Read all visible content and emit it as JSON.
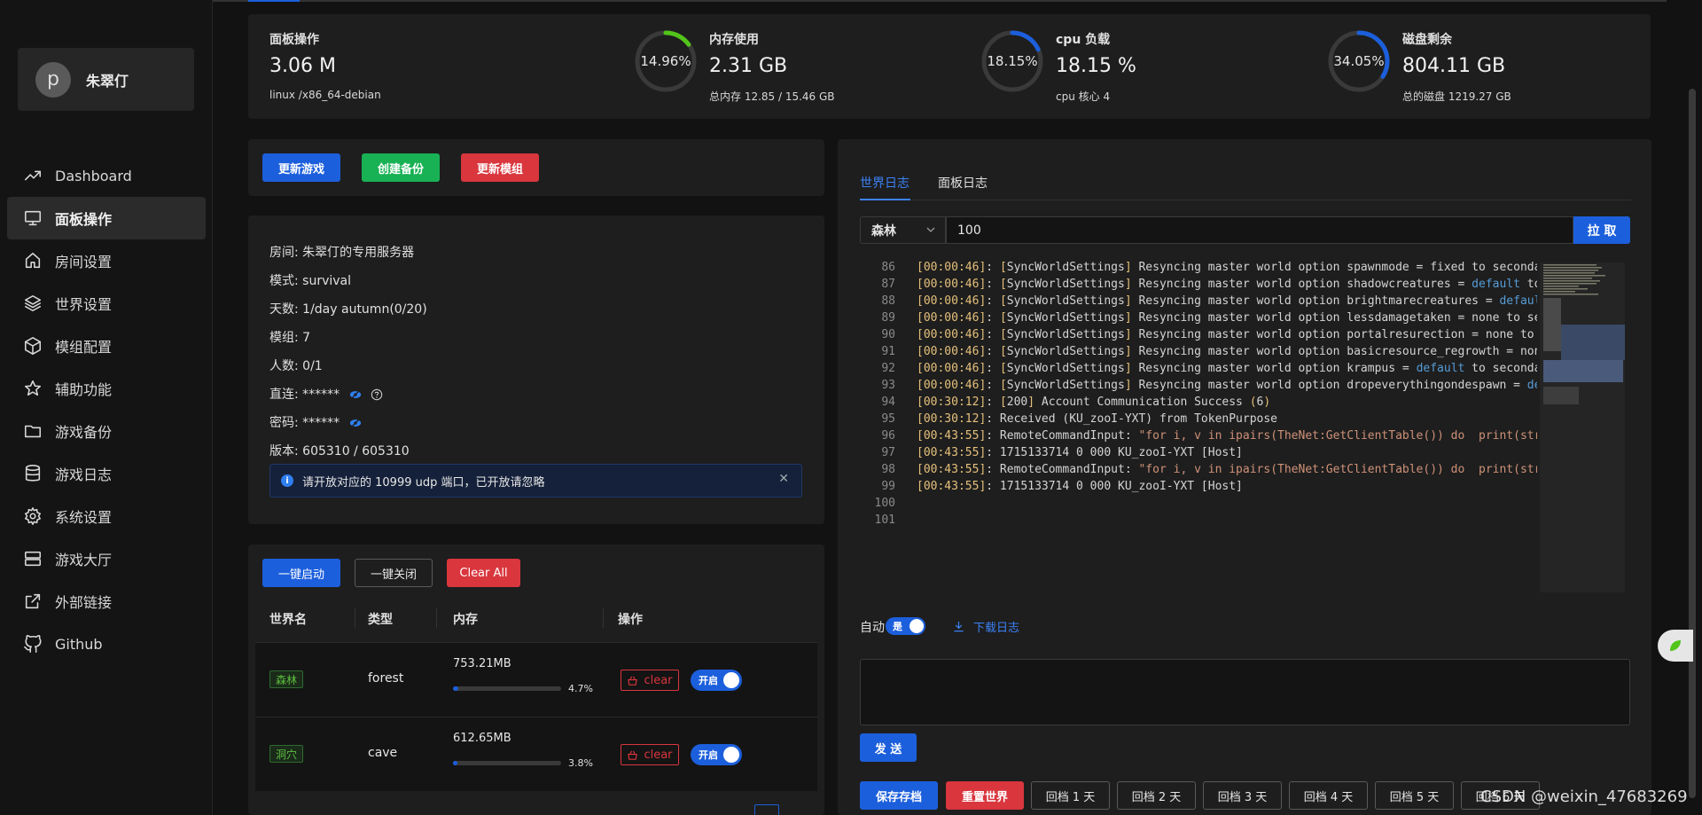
{
  "user": {
    "initial": "p",
    "name": "朱翠仃"
  },
  "menu": [
    {
      "label": "Dashboard",
      "icon": "trend-icon",
      "active": false
    },
    {
      "label": "面板操作",
      "icon": "monitor-icon",
      "active": true
    },
    {
      "label": "房间设置",
      "icon": "home-icon",
      "active": false
    },
    {
      "label": "世界设置",
      "icon": "layers-icon",
      "active": false
    },
    {
      "label": "模组配置",
      "icon": "cube-icon",
      "active": false
    },
    {
      "label": "辅助功能",
      "icon": "star-icon",
      "active": false
    },
    {
      "label": "游戏备份",
      "icon": "folder-icon",
      "active": false
    },
    {
      "label": "游戏日志",
      "icon": "database-icon",
      "active": false
    },
    {
      "label": "系统设置",
      "icon": "gear-icon",
      "active": false
    },
    {
      "label": "游戏大厅",
      "icon": "server-icon",
      "active": false
    },
    {
      "label": "外部链接",
      "icon": "external-link-icon",
      "active": false
    },
    {
      "label": "Github",
      "icon": "github-icon",
      "active": false
    }
  ],
  "stats": {
    "panel": {
      "title": "面板操作",
      "value": "3.06 M",
      "sub": "linux /x86_64-debian"
    },
    "memory": {
      "title": "内存使用",
      "value": "2.31 GB",
      "sub": "总内存  12.85 / 15.46 GB",
      "ring_label": "14.96%",
      "fraction": 0.1496,
      "color": "#52c41a"
    },
    "cpu": {
      "title": "cpu 负载",
      "value": "18.15 %",
      "sub": "cpu 核心  4",
      "ring_label": "18.15%",
      "fraction": 0.1815,
      "color": "#1c5fdc"
    },
    "disk": {
      "title": "磁盘剩余",
      "value": "804.11 GB",
      "sub": "总的磁盘  1219.27 GB",
      "ring_label": "34.05%",
      "fraction": 0.3405,
      "color": "#1c5fdc"
    }
  },
  "actions": {
    "update_game": "更新游戏",
    "create_backup": "创建备份",
    "update_mods": "更新模组"
  },
  "room": {
    "name": "房间: 朱翠仃的专用服务器",
    "mode": "模式: survival",
    "days": "天数: 1/day autumn(0/20)",
    "mods": "模组: 7",
    "players": "人数: 0/1",
    "direct": "直连: ******",
    "password": "密码: ******",
    "version": "版本: 605310 / 605310",
    "notice": "请开放对应的 10999 udp 端口，已开放请忽略"
  },
  "worlds": {
    "start_all": "一键启动",
    "stop_all": "一键关闭",
    "clear_all": "Clear All",
    "columns": [
      "世界名",
      "类型",
      "内存",
      "操作"
    ],
    "rows": [
      {
        "tag": "森林",
        "type": "forest",
        "memory": "753.21MB",
        "percent": "4.7%",
        "fraction": 0.047,
        "clear": "clear",
        "toggle": "开启"
      },
      {
        "tag": "洞穴",
        "type": "cave",
        "memory": "612.65MB",
        "percent": "3.8%",
        "fraction": 0.038,
        "clear": "clear",
        "toggle": "开启"
      }
    ]
  },
  "log": {
    "tabs": [
      "世界日志",
      "面板日志"
    ],
    "select_value": "森林",
    "lines_value": "100",
    "pull": "拉 取",
    "lines": [
      {
        "n": "86",
        "t": "00:00:46",
        "src": "SyncWorldSettings",
        "msg": " Resyncing master world option spawnmode = fixed to secondar"
      },
      {
        "n": "87",
        "t": "00:00:46",
        "src": "SyncWorldSettings",
        "msg": " Resyncing master world option shadowcreatures = ",
        "kw": "default",
        "rest": " to"
      },
      {
        "n": "88",
        "t": "00:00:46",
        "src": "SyncWorldSettings",
        "msg": " Resyncing master world option brightmarecreatures = ",
        "kw": "default",
        "rest": ""
      },
      {
        "n": "89",
        "t": "00:00:46",
        "src": "SyncWorldSettings",
        "msg": " Resyncing master world option lessdamagetaken = none to sec"
      },
      {
        "n": "90",
        "t": "00:00:46",
        "src": "SyncWorldSettings",
        "msg": " Resyncing master world option portalresurection = none to s"
      },
      {
        "n": "91",
        "t": "00:00:46",
        "src": "SyncWorldSettings",
        "msg": " Resyncing master world option basicresource_regrowth = none"
      },
      {
        "n": "92",
        "t": "00:00:46",
        "src": "SyncWorldSettings",
        "msg": " Resyncing master world option krampus = ",
        "kw": "default",
        "rest": " to secondar"
      },
      {
        "n": "93",
        "t": "00:00:46",
        "src": "SyncWorldSettings",
        "msg": " Resyncing master world option dropeverythingondespawn = ",
        "kw": "def",
        "rest": ""
      },
      {
        "n": "94",
        "t": "00:30:12",
        "src": "200",
        "msg": " Account Communication Success (6)"
      },
      {
        "n": "95",
        "t": "00:30:12",
        "plain": " Received (KU_zooI-YXT) from TokenPurpose"
      },
      {
        "n": "96",
        "t": "00:43:55",
        "plain": " RemoteCommandInput: ",
        "str": "\"for i, v in ipairs(TheNet:GetClientTable()) do  print(stri"
      },
      {
        "n": "97",
        "t": "00:43:55",
        "plain": " 1715133714 0 000 KU_zooI-YXT [Host]"
      },
      {
        "n": "98",
        "t": "00:43:55",
        "plain": " RemoteCommandInput: ",
        "str": "\"for i, v in ipairs(TheNet:GetClientTable()) do  print(stri"
      },
      {
        "n": "99",
        "t": "00:43:55",
        "plain": " 1715133714 0 000 KU_zooI-YXT [Host]"
      },
      {
        "n": "100"
      },
      {
        "n": "101"
      }
    ],
    "auto_label": "自动",
    "auto_toggle": "是",
    "download": "下载日志",
    "send": "发 送",
    "bottom_buttons": [
      "保存存档",
      "重置世界",
      "回档 1 天",
      "回档 2 天",
      "回档 3 天",
      "回档 4 天",
      "回档 5 天",
      "回档 6 天"
    ]
  },
  "watermark": "CSDN @weixin_47683269"
}
